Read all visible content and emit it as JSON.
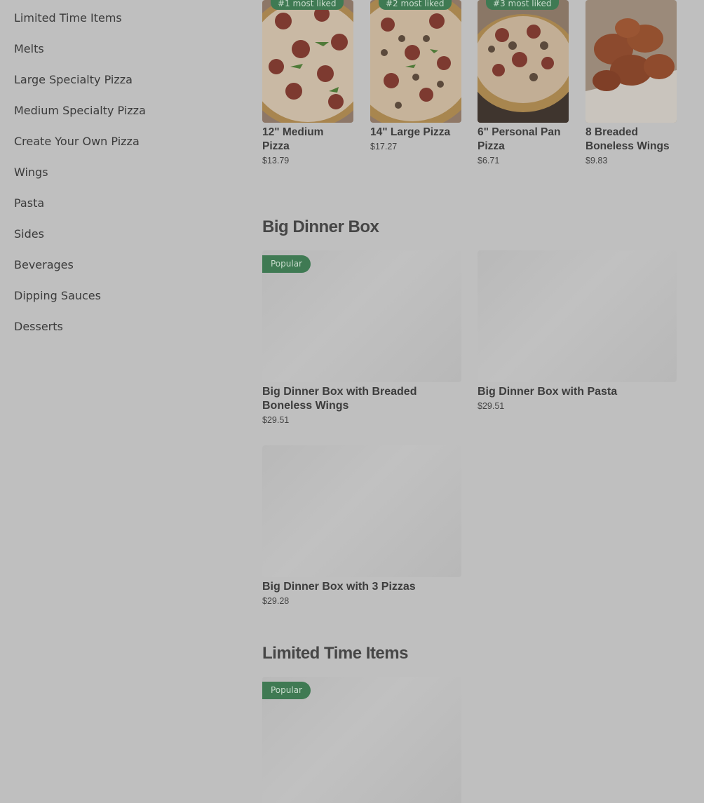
{
  "sidebar": {
    "items": [
      {
        "label": "Limited Time Items"
      },
      {
        "label": "Melts"
      },
      {
        "label": "Large Specialty Pizza"
      },
      {
        "label": "Medium Specialty Pizza"
      },
      {
        "label": "Create Your Own Pizza"
      },
      {
        "label": "Wings"
      },
      {
        "label": "Pasta"
      },
      {
        "label": "Sides"
      },
      {
        "label": "Beverages"
      },
      {
        "label": "Dipping Sauces"
      },
      {
        "label": "Desserts"
      }
    ]
  },
  "most_liked": [
    {
      "badge": "#1 most liked",
      "title": "12\" Medium Pizza",
      "price": "$13.79",
      "image": "pepperoni-pizza"
    },
    {
      "badge": "#2 most liked",
      "title": "14\" Large Pizza",
      "price": "$17.27",
      "image": "supreme-pizza"
    },
    {
      "badge": "#3 most liked",
      "title": "6\" Personal Pan Pizza",
      "price": "$6.71",
      "image": "pan-pizza"
    },
    {
      "badge": "",
      "title": "8 Breaded Boneless Wings",
      "price": "$9.83",
      "image": "boneless-wings"
    }
  ],
  "big_dinner_box": {
    "heading": "Big Dinner Box",
    "items": [
      {
        "title": "Big Dinner Box with Breaded Boneless Wings",
        "price": "$29.51",
        "badge": "Popular"
      },
      {
        "title": "Big Dinner Box with Pasta",
        "price": "$29.51",
        "badge": ""
      },
      {
        "title": "Big Dinner Box with 3 Pizzas",
        "price": "$29.28",
        "badge": ""
      }
    ]
  },
  "limited_time": {
    "heading": "Limited Time Items",
    "items": [
      {
        "badge": "Popular"
      }
    ]
  },
  "colors": {
    "overlay": "#bfbfbf",
    "badge_green": "#3f7a53"
  }
}
